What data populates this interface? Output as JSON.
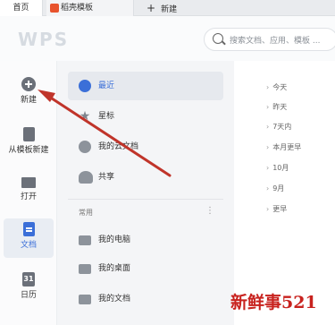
{
  "tabs": {
    "home": "首页",
    "template": "稻壳模板",
    "new_tab": "新建"
  },
  "header": {
    "brand": "WPS",
    "search_placeholder": "搜索文档、应用、模板 ..."
  },
  "rail": {
    "items": [
      {
        "label": "新建",
        "icon": "new-icon"
      },
      {
        "label": "从模板新建",
        "icon": "template-icon"
      },
      {
        "label": "打开",
        "icon": "folder-open-icon"
      },
      {
        "label": "文档",
        "icon": "document-icon"
      },
      {
        "label": "日历",
        "icon": "calendar-icon",
        "glyph": "31"
      }
    ]
  },
  "nav": {
    "items": [
      {
        "label": "最近",
        "icon": "clock-icon"
      },
      {
        "label": "星标",
        "icon": "star-icon",
        "glyph": "★"
      },
      {
        "label": "我的云文档",
        "icon": "cloud-icon"
      },
      {
        "label": "共享",
        "icon": "people-icon"
      }
    ],
    "section_title": "常用",
    "section_more": "⋮",
    "common": [
      {
        "label": "我的电脑",
        "icon": "computer-icon"
      },
      {
        "label": "我的桌面",
        "icon": "desktop-icon"
      },
      {
        "label": "我的文档",
        "icon": "folder-icon"
      }
    ]
  },
  "timeline": {
    "chevron": "›",
    "groups": [
      "今天",
      "昨天",
      "7天内",
      "本月更早",
      "10月",
      "9月",
      "更早"
    ]
  },
  "watermark": "新鲜事521",
  "colors": {
    "accent": "#3b6fd8",
    "arrow": "#c0342a",
    "watermark": "#c8221e"
  }
}
